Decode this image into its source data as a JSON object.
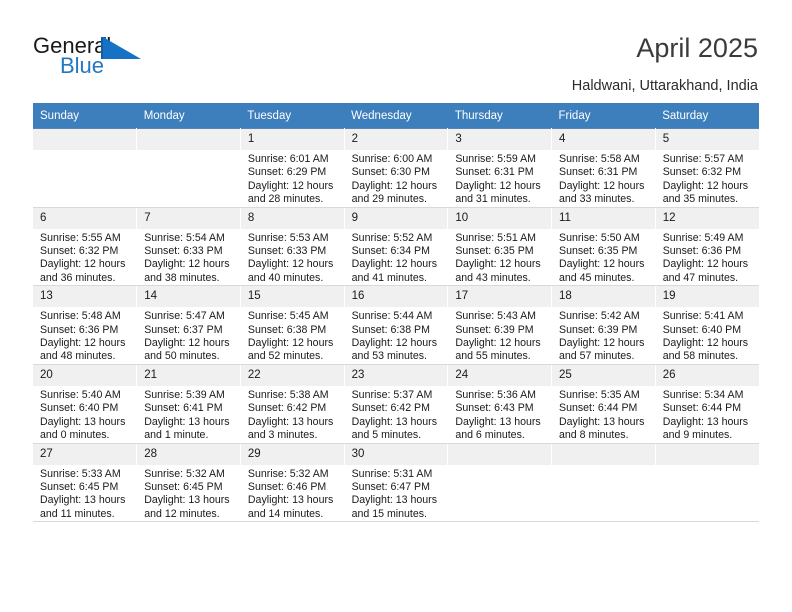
{
  "logo": {
    "word1": "General",
    "word2": "Blue",
    "mark": "triangle-flag"
  },
  "header": {
    "title": "April 2025",
    "subtitle": "Haldwani, Uttarakhand, India"
  },
  "colors": {
    "header_blue": "#3d7ebc",
    "logo_blue": "#2478c0",
    "day_band": "#f0f0f0",
    "grid_line": "#d9d9d9"
  },
  "calendar": {
    "weekdays": [
      "Sunday",
      "Monday",
      "Tuesday",
      "Wednesday",
      "Thursday",
      "Friday",
      "Saturday"
    ],
    "labels": {
      "sunrise": "Sunrise:",
      "sunset": "Sunset:",
      "daylight": "Daylight:"
    },
    "weeks": [
      [
        {
          "day": ""
        },
        {
          "day": ""
        },
        {
          "day": "1",
          "sunrise": "Sunrise: 6:01 AM",
          "sunset": "Sunset: 6:29 PM",
          "daylight1": "Daylight: 12 hours",
          "daylight2": "and 28 minutes."
        },
        {
          "day": "2",
          "sunrise": "Sunrise: 6:00 AM",
          "sunset": "Sunset: 6:30 PM",
          "daylight1": "Daylight: 12 hours",
          "daylight2": "and 29 minutes."
        },
        {
          "day": "3",
          "sunrise": "Sunrise: 5:59 AM",
          "sunset": "Sunset: 6:31 PM",
          "daylight1": "Daylight: 12 hours",
          "daylight2": "and 31 minutes."
        },
        {
          "day": "4",
          "sunrise": "Sunrise: 5:58 AM",
          "sunset": "Sunset: 6:31 PM",
          "daylight1": "Daylight: 12 hours",
          "daylight2": "and 33 minutes."
        },
        {
          "day": "5",
          "sunrise": "Sunrise: 5:57 AM",
          "sunset": "Sunset: 6:32 PM",
          "daylight1": "Daylight: 12 hours",
          "daylight2": "and 35 minutes."
        }
      ],
      [
        {
          "day": "6",
          "sunrise": "Sunrise: 5:55 AM",
          "sunset": "Sunset: 6:32 PM",
          "daylight1": "Daylight: 12 hours",
          "daylight2": "and 36 minutes."
        },
        {
          "day": "7",
          "sunrise": "Sunrise: 5:54 AM",
          "sunset": "Sunset: 6:33 PM",
          "daylight1": "Daylight: 12 hours",
          "daylight2": "and 38 minutes."
        },
        {
          "day": "8",
          "sunrise": "Sunrise: 5:53 AM",
          "sunset": "Sunset: 6:33 PM",
          "daylight1": "Daylight: 12 hours",
          "daylight2": "and 40 minutes."
        },
        {
          "day": "9",
          "sunrise": "Sunrise: 5:52 AM",
          "sunset": "Sunset: 6:34 PM",
          "daylight1": "Daylight: 12 hours",
          "daylight2": "and 41 minutes."
        },
        {
          "day": "10",
          "sunrise": "Sunrise: 5:51 AM",
          "sunset": "Sunset: 6:35 PM",
          "daylight1": "Daylight: 12 hours",
          "daylight2": "and 43 minutes."
        },
        {
          "day": "11",
          "sunrise": "Sunrise: 5:50 AM",
          "sunset": "Sunset: 6:35 PM",
          "daylight1": "Daylight: 12 hours",
          "daylight2": "and 45 minutes."
        },
        {
          "day": "12",
          "sunrise": "Sunrise: 5:49 AM",
          "sunset": "Sunset: 6:36 PM",
          "daylight1": "Daylight: 12 hours",
          "daylight2": "and 47 minutes."
        }
      ],
      [
        {
          "day": "13",
          "sunrise": "Sunrise: 5:48 AM",
          "sunset": "Sunset: 6:36 PM",
          "daylight1": "Daylight: 12 hours",
          "daylight2": "and 48 minutes."
        },
        {
          "day": "14",
          "sunrise": "Sunrise: 5:47 AM",
          "sunset": "Sunset: 6:37 PM",
          "daylight1": "Daylight: 12 hours",
          "daylight2": "and 50 minutes."
        },
        {
          "day": "15",
          "sunrise": "Sunrise: 5:45 AM",
          "sunset": "Sunset: 6:38 PM",
          "daylight1": "Daylight: 12 hours",
          "daylight2": "and 52 minutes."
        },
        {
          "day": "16",
          "sunrise": "Sunrise: 5:44 AM",
          "sunset": "Sunset: 6:38 PM",
          "daylight1": "Daylight: 12 hours",
          "daylight2": "and 53 minutes."
        },
        {
          "day": "17",
          "sunrise": "Sunrise: 5:43 AM",
          "sunset": "Sunset: 6:39 PM",
          "daylight1": "Daylight: 12 hours",
          "daylight2": "and 55 minutes."
        },
        {
          "day": "18",
          "sunrise": "Sunrise: 5:42 AM",
          "sunset": "Sunset: 6:39 PM",
          "daylight1": "Daylight: 12 hours",
          "daylight2": "and 57 minutes."
        },
        {
          "day": "19",
          "sunrise": "Sunrise: 5:41 AM",
          "sunset": "Sunset: 6:40 PM",
          "daylight1": "Daylight: 12 hours",
          "daylight2": "and 58 minutes."
        }
      ],
      [
        {
          "day": "20",
          "sunrise": "Sunrise: 5:40 AM",
          "sunset": "Sunset: 6:40 PM",
          "daylight1": "Daylight: 13 hours",
          "daylight2": "and 0 minutes."
        },
        {
          "day": "21",
          "sunrise": "Sunrise: 5:39 AM",
          "sunset": "Sunset: 6:41 PM",
          "daylight1": "Daylight: 13 hours",
          "daylight2": "and 1 minute."
        },
        {
          "day": "22",
          "sunrise": "Sunrise: 5:38 AM",
          "sunset": "Sunset: 6:42 PM",
          "daylight1": "Daylight: 13 hours",
          "daylight2": "and 3 minutes."
        },
        {
          "day": "23",
          "sunrise": "Sunrise: 5:37 AM",
          "sunset": "Sunset: 6:42 PM",
          "daylight1": "Daylight: 13 hours",
          "daylight2": "and 5 minutes."
        },
        {
          "day": "24",
          "sunrise": "Sunrise: 5:36 AM",
          "sunset": "Sunset: 6:43 PM",
          "daylight1": "Daylight: 13 hours",
          "daylight2": "and 6 minutes."
        },
        {
          "day": "25",
          "sunrise": "Sunrise: 5:35 AM",
          "sunset": "Sunset: 6:44 PM",
          "daylight1": "Daylight: 13 hours",
          "daylight2": "and 8 minutes."
        },
        {
          "day": "26",
          "sunrise": "Sunrise: 5:34 AM",
          "sunset": "Sunset: 6:44 PM",
          "daylight1": "Daylight: 13 hours",
          "daylight2": "and 9 minutes."
        }
      ],
      [
        {
          "day": "27",
          "sunrise": "Sunrise: 5:33 AM",
          "sunset": "Sunset: 6:45 PM",
          "daylight1": "Daylight: 13 hours",
          "daylight2": "and 11 minutes."
        },
        {
          "day": "28",
          "sunrise": "Sunrise: 5:32 AM",
          "sunset": "Sunset: 6:45 PM",
          "daylight1": "Daylight: 13 hours",
          "daylight2": "and 12 minutes."
        },
        {
          "day": "29",
          "sunrise": "Sunrise: 5:32 AM",
          "sunset": "Sunset: 6:46 PM",
          "daylight1": "Daylight: 13 hours",
          "daylight2": "and 14 minutes."
        },
        {
          "day": "30",
          "sunrise": "Sunrise: 5:31 AM",
          "sunset": "Sunset: 6:47 PM",
          "daylight1": "Daylight: 13 hours",
          "daylight2": "and 15 minutes."
        },
        {
          "day": ""
        },
        {
          "day": ""
        },
        {
          "day": ""
        }
      ]
    ]
  }
}
